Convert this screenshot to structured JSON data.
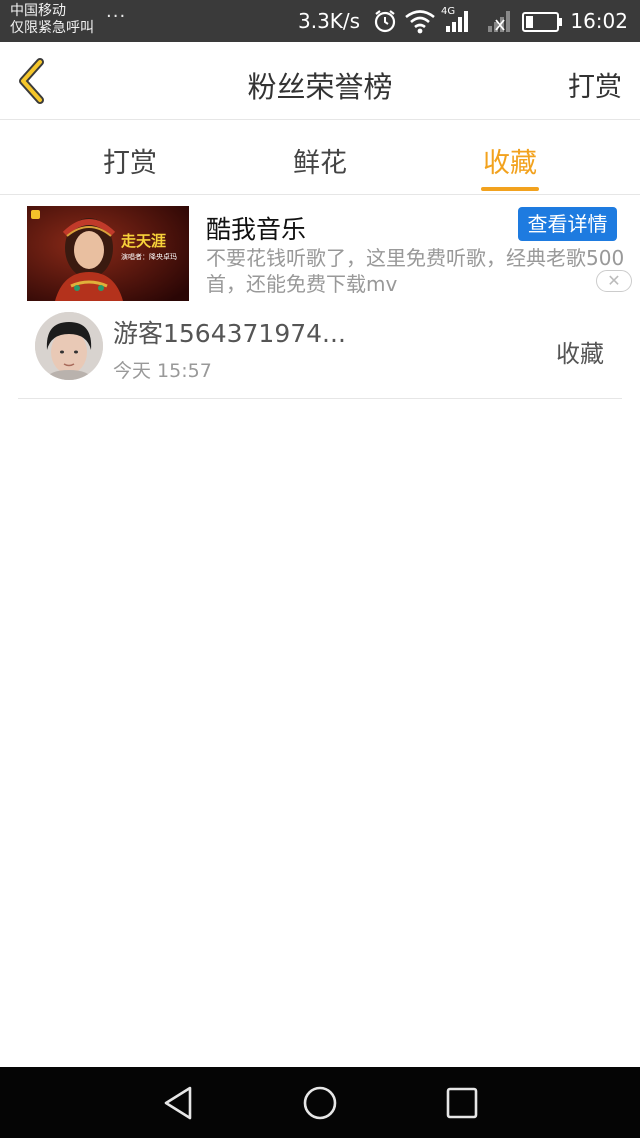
{
  "status_bar": {
    "carrier_line1": "中国移动",
    "carrier_line2": "仅限紧急呼叫",
    "more": "···",
    "speed": "3.3K/s",
    "network_label": "4G",
    "time": "16:02",
    "icons": [
      "alarm-icon",
      "wifi-icon",
      "signal-4g-icon",
      "signal-no-sim-icon",
      "battery-icon"
    ]
  },
  "header": {
    "title": "粉丝荣誉榜",
    "right_action": "打赏",
    "back_icon": "chevron-left-icon"
  },
  "tabs": [
    {
      "label": "打赏",
      "active": false
    },
    {
      "label": "鲜花",
      "active": false
    },
    {
      "label": "收藏",
      "active": true
    }
  ],
  "ad": {
    "title": "酷我音乐",
    "button": "查看详情",
    "description": "不要花钱听歌了，这里免费听歌，经典老歌500首，还能免费下载mv",
    "image_title": "走天涯",
    "image_subtitle": "演唱者：降央卓玛",
    "close_icon": "close-icon"
  },
  "list": [
    {
      "name": "游客1564371974...",
      "time": "今天 15:57",
      "action": "收藏"
    }
  ],
  "nav_bar": {
    "buttons": [
      "back-triangle-icon",
      "home-circle-icon",
      "recents-square-icon"
    ]
  },
  "colors": {
    "accent": "#f2a21e",
    "ad_button": "#1e7be0",
    "status_bar": "#3a3a3a",
    "nav_bar": "#050505"
  }
}
